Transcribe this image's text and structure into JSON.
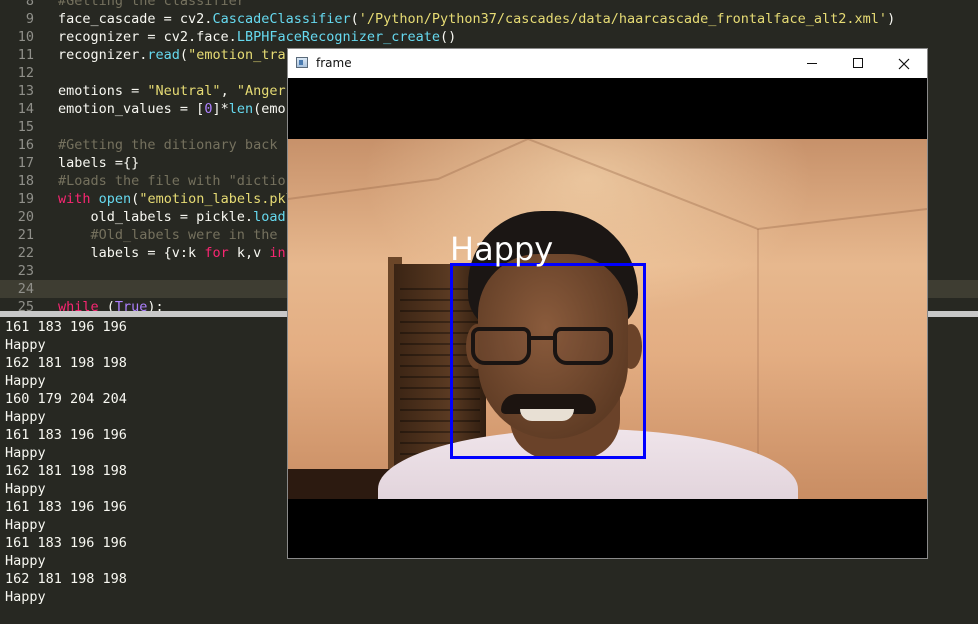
{
  "editor": {
    "lines": [
      {
        "num": "8",
        "tokens": [
          {
            "t": "#Getting the classifier",
            "c": "cm"
          }
        ]
      },
      {
        "num": "9",
        "tokens": [
          {
            "t": "face_cascade = cv2."
          },
          {
            "t": "CascadeClassifier",
            "c": "fn"
          },
          {
            "t": "("
          },
          {
            "t": "'/Python/Python37/cascades/data/haarcascade_frontalface_alt2.xml'",
            "c": "str"
          },
          {
            "t": ")"
          }
        ]
      },
      {
        "num": "10",
        "tokens": [
          {
            "t": "recognizer = cv2.face."
          },
          {
            "t": "LBPHFaceRecognizer_create",
            "c": "fn"
          },
          {
            "t": "()"
          }
        ]
      },
      {
        "num": "11",
        "tokens": [
          {
            "t": "recognizer."
          },
          {
            "t": "read",
            "c": "fn"
          },
          {
            "t": "("
          },
          {
            "t": "\"emotion_tra",
            "c": "str"
          }
        ]
      },
      {
        "num": "12",
        "tokens": []
      },
      {
        "num": "13",
        "tokens": [
          {
            "t": "emotions = "
          },
          {
            "t": "\"Neutral\"",
            "c": "str"
          },
          {
            "t": ", "
          },
          {
            "t": "\"Anger",
            "c": "str"
          }
        ]
      },
      {
        "num": "14",
        "tokens": [
          {
            "t": "emotion_values = ["
          },
          {
            "t": "0",
            "c": "num"
          },
          {
            "t": "]*"
          },
          {
            "t": "len",
            "c": "fn"
          },
          {
            "t": "(emo"
          }
        ]
      },
      {
        "num": "15",
        "tokens": []
      },
      {
        "num": "16",
        "tokens": [
          {
            "t": "#Getting the ditionary back",
            "c": "cm"
          }
        ]
      },
      {
        "num": "17",
        "tokens": [
          {
            "t": "labels ={}"
          }
        ]
      },
      {
        "num": "18",
        "tokens": [
          {
            "t": "#Loads the file with \"dictio",
            "c": "cm"
          }
        ]
      },
      {
        "num": "19",
        "tokens": [
          {
            "t": "with",
            "c": "kw"
          },
          {
            "t": " "
          },
          {
            "t": "open",
            "c": "fn"
          },
          {
            "t": "("
          },
          {
            "t": "\"emotion_labels.pkl",
            "c": "str"
          }
        ]
      },
      {
        "num": "20",
        "tokens": [
          {
            "t": "    old_labels = pickle."
          },
          {
            "t": "load",
            "c": "fn"
          }
        ]
      },
      {
        "num": "21",
        "tokens": [
          {
            "t": "    #Old_labels were in the",
            "c": "cm"
          }
        ]
      },
      {
        "num": "22",
        "tokens": [
          {
            "t": "    labels = {v:k "
          },
          {
            "t": "for",
            "c": "kw"
          },
          {
            "t": " k,v "
          },
          {
            "t": "in",
            "c": "kw"
          }
        ]
      },
      {
        "num": "23",
        "tokens": []
      },
      {
        "num": "24",
        "tokens": [],
        "current": true
      },
      {
        "num": "25",
        "tokens": [
          {
            "t": "while",
            "c": "kw"
          },
          {
            "t": " ("
          },
          {
            "t": "True",
            "c": "num"
          },
          {
            "t": "):"
          }
        ]
      }
    ]
  },
  "console": {
    "lines": [
      "161 183 196 196",
      "Happy",
      "162 181 198 198",
      "Happy",
      "160 179 204 204",
      "Happy",
      "161 183 196 196",
      "Happy",
      "162 181 198 198",
      "Happy",
      "161 183 196 196",
      "Happy",
      "161 183 196 196",
      "Happy",
      "162 181 198 198",
      "Happy"
    ]
  },
  "frame_window": {
    "title": "frame",
    "emotion_label": "Happy",
    "box_color": "#0000ff"
  },
  "colors": {
    "editor_bg": "#272822",
    "keyword": "#f92672",
    "string": "#e6db74",
    "function": "#66d9ef",
    "number": "#ae81ff",
    "comment": "#75715e"
  }
}
